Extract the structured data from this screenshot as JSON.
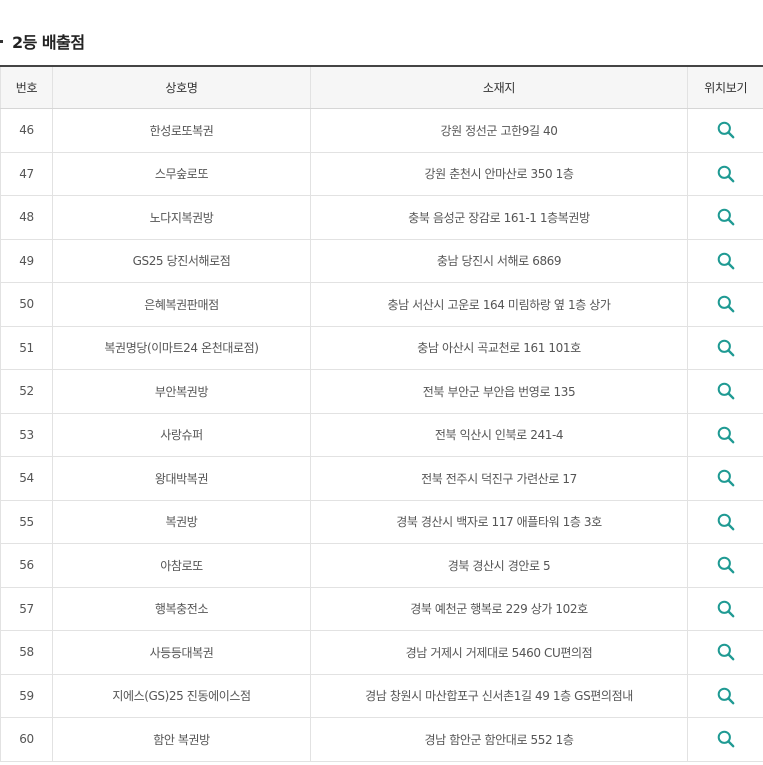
{
  "section": {
    "title": "2등 배출점"
  },
  "table": {
    "headers": {
      "no": "번호",
      "name": "상호명",
      "address": "소재지",
      "map": "위치보기"
    },
    "rows": [
      {
        "no": "46",
        "name": "한성로또복권",
        "address": "강원 정선군 고한9길 40"
      },
      {
        "no": "47",
        "name": "스무숲로또",
        "address": "강원 춘천시 안마산로 350 1층"
      },
      {
        "no": "48",
        "name": "노다지복권방",
        "address": "충북 음성군 장감로 161-1 1층복권방"
      },
      {
        "no": "49",
        "name": "GS25 당진서해로점",
        "address": "충남 당진시 서해로 6869"
      },
      {
        "no": "50",
        "name": "은혜복권판매점",
        "address": "충남 서산시 고운로 164 미림하랑 옆 1층 상가"
      },
      {
        "no": "51",
        "name": "복권명당(이마트24 온천대로점)",
        "address": "충남 아산시 곡교천로 161 101호"
      },
      {
        "no": "52",
        "name": "부안복권방",
        "address": "전북 부안군 부안읍 번영로 135"
      },
      {
        "no": "53",
        "name": "사랑슈퍼",
        "address": "전북 익산시 인북로 241-4"
      },
      {
        "no": "54",
        "name": "왕대박복권",
        "address": "전북 전주시 덕진구 가련산로 17"
      },
      {
        "no": "55",
        "name": "복권방",
        "address": "경북 경산시 백자로 117 애플타워 1층 3호"
      },
      {
        "no": "56",
        "name": "아참로또",
        "address": "경북 경산시 경안로 5"
      },
      {
        "no": "57",
        "name": "행복충전소",
        "address": "경북 예천군 행복로 229 상가 102호"
      },
      {
        "no": "58",
        "name": "사등등대복권",
        "address": "경남 거제시 거제대로 5460 CU편의점"
      },
      {
        "no": "59",
        "name": "지에스(GS)25 진동에이스점",
        "address": "경남 창원시 마산합포구 신서촌1길 49 1층 GS편의점내"
      },
      {
        "no": "60",
        "name": "함안 복권방",
        "address": "경남 함안군 함안대로 552 1층"
      }
    ]
  },
  "icons": {
    "map_view": "search-icon"
  },
  "colors": {
    "accent": "#1f9a93",
    "header_border": "#444444",
    "header_bg": "#f6f6f6"
  }
}
